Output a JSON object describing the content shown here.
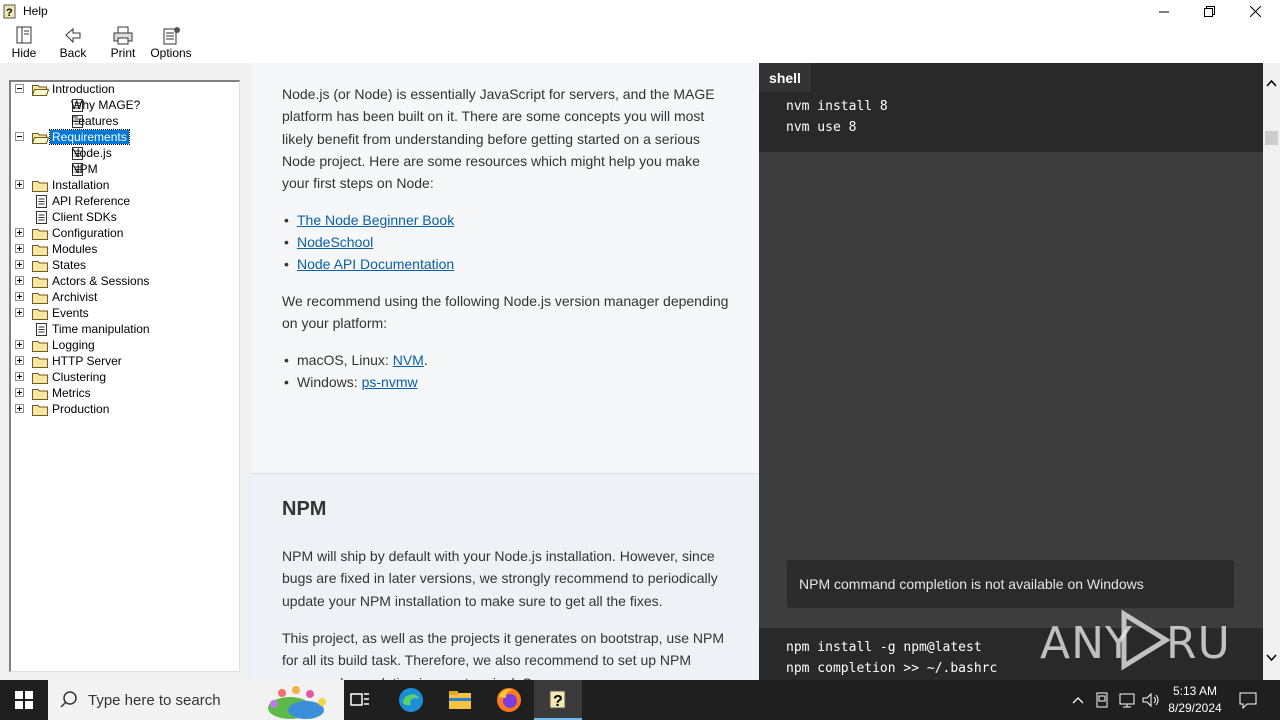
{
  "window": {
    "title": "Help",
    "minimize": "─",
    "maximize": "⧉",
    "close": "✕"
  },
  "toolbar": {
    "buttons": [
      {
        "label": "Hide",
        "icon": "hide-icon"
      },
      {
        "label": "Back",
        "icon": "back-arrow-icon"
      },
      {
        "label": "Print",
        "icon": "printer-icon"
      },
      {
        "label": "Options",
        "icon": "options-icon"
      }
    ]
  },
  "tree": {
    "items": [
      {
        "label": "Introduction",
        "type": "folder-open",
        "expander": "minus",
        "level": 0
      },
      {
        "label": "Why MAGE?",
        "type": "page",
        "level": 1
      },
      {
        "label": "Features",
        "type": "page",
        "level": 1
      },
      {
        "label": "Requirements",
        "type": "folder-open",
        "expander": "minus",
        "level": 0,
        "selected": true
      },
      {
        "label": "Node.js",
        "type": "page",
        "level": 1
      },
      {
        "label": "NPM",
        "type": "page",
        "level": 1
      },
      {
        "label": "Installation",
        "type": "folder",
        "expander": "plus",
        "level": 0
      },
      {
        "label": "API Reference",
        "type": "page",
        "level": 0
      },
      {
        "label": "Client SDKs",
        "type": "page",
        "level": 0
      },
      {
        "label": "Configuration",
        "type": "folder",
        "expander": "plus",
        "level": 0
      },
      {
        "label": "Modules",
        "type": "folder",
        "expander": "plus",
        "level": 0
      },
      {
        "label": "States",
        "type": "folder",
        "expander": "plus",
        "level": 0
      },
      {
        "label": "Actors & Sessions",
        "type": "folder",
        "expander": "plus",
        "level": 0
      },
      {
        "label": "Archivist",
        "type": "folder",
        "expander": "plus",
        "level": 0
      },
      {
        "label": "Events",
        "type": "folder",
        "expander": "plus",
        "level": 0
      },
      {
        "label": "Time manipulation",
        "type": "page",
        "level": 0
      },
      {
        "label": "Logging",
        "type": "folder",
        "expander": "plus",
        "level": 0
      },
      {
        "label": "HTTP Server",
        "type": "folder",
        "expander": "plus",
        "level": 0
      },
      {
        "label": "Clustering",
        "type": "folder",
        "expander": "plus",
        "level": 0
      },
      {
        "label": "Metrics",
        "type": "folder",
        "expander": "plus",
        "level": 0
      },
      {
        "label": "Production",
        "type": "folder",
        "expander": "plus",
        "level": 0
      }
    ]
  },
  "content": {
    "node_lines": [
      "Node.js (or Node) is essentially JavaScript for servers, and the MAGE",
      "platform has been built on it. There are some concepts you will most",
      "likely benefit from understanding before getting started on a serious",
      "Node project. Here are some resources which might help you make",
      "your first steps on Node:"
    ],
    "resource_links": [
      "The Node Beginner Book",
      "NodeSchool",
      "Node API Documentation"
    ],
    "recommend_lines": [
      "We recommend using the following Node.js version manager depending",
      "on your platform:"
    ],
    "platforms": [
      {
        "prefix": "macOS, Linux: ",
        "link": "NVM",
        "suffix": "."
      },
      {
        "prefix": "Windows: ",
        "link": "ps-nvmw",
        "suffix": ""
      }
    ],
    "npm_heading": "NPM",
    "npm_lines": [
      "NPM will ship by default with your Node.js installation. However, since",
      "bugs are fixed in later versions, we strongly recommend to periodically",
      "update your NPM installation to make sure to get all the fixes."
    ],
    "project_lines": [
      "This project, as well as the projects it generates on bootstrap, use NPM",
      "for all its build task. Therefore, we also recommend to set up NPM",
      "command completion in your terminal. See"
    ]
  },
  "code": {
    "tab_label": "shell",
    "block1": [
      "nvm install 8",
      "nvm use 8"
    ],
    "note": "NPM command completion is not available on Windows",
    "block2": [
      "npm install -g npm@latest",
      "npm completion >> ~/.bashrc"
    ]
  },
  "watermark": "ANY RUN",
  "taskbar": {
    "search_placeholder": "Type here to search",
    "apps": [
      "task-view-icon",
      "edge-icon",
      "file-explorer-icon",
      "firefox-icon",
      "help-icon"
    ],
    "time": "5:13 AM",
    "date": "8/29/2024"
  },
  "colors": {
    "selection": "#0078d7",
    "link": "#0a5fa8",
    "code_bg": "#292929",
    "taskbar": "#1f1f1f"
  }
}
